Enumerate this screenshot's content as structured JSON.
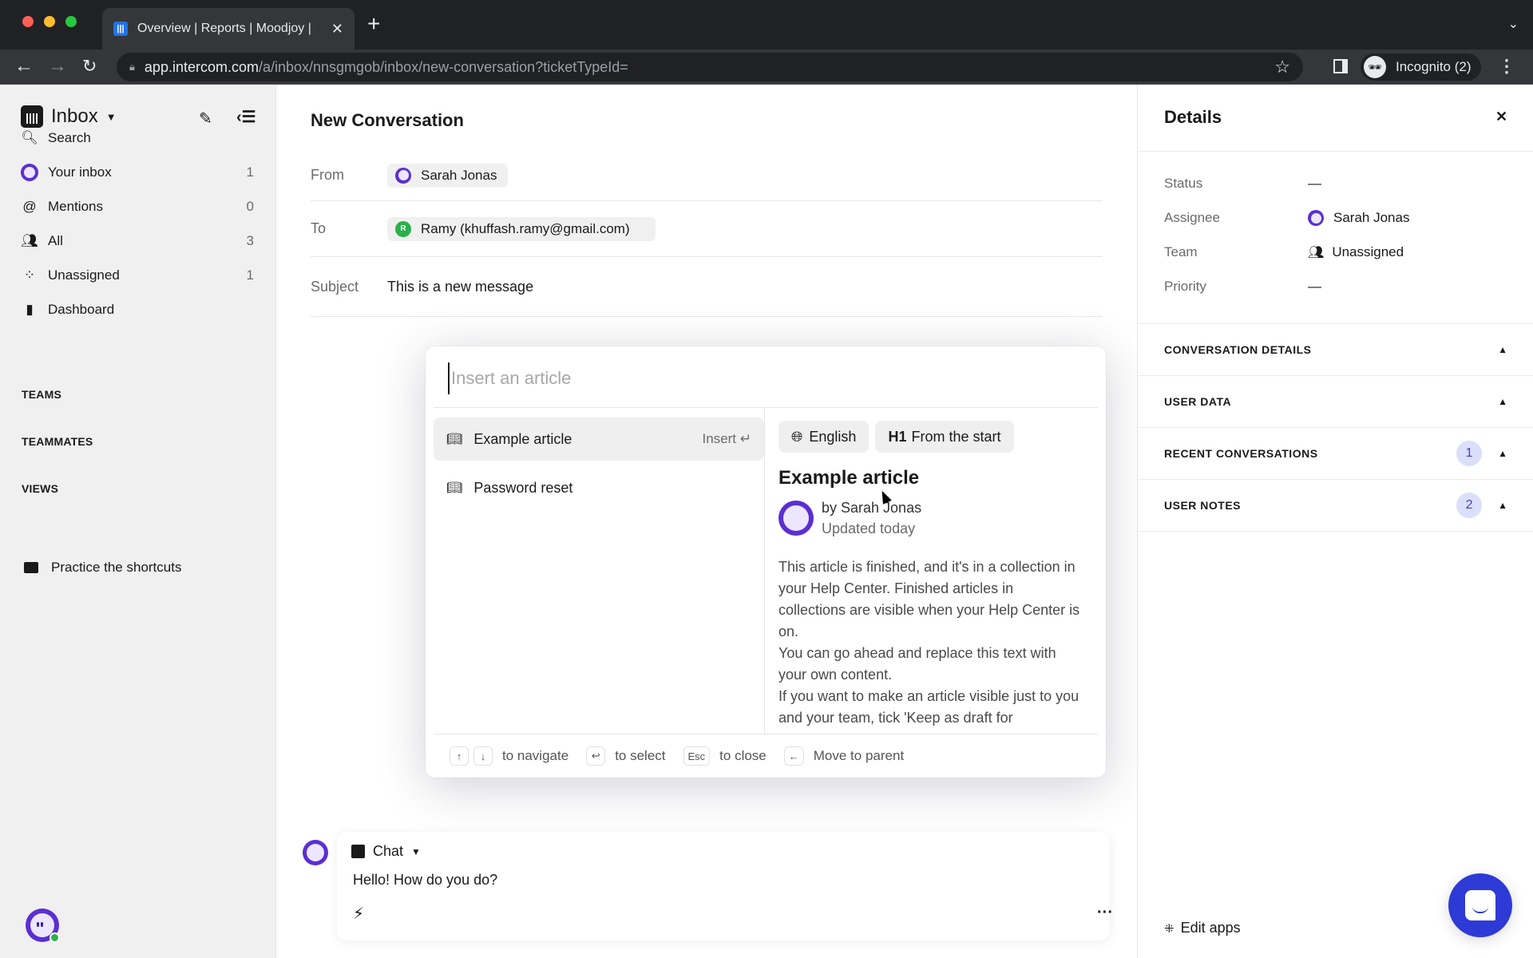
{
  "browser": {
    "tab_title": "Overview | Reports | Moodjoy |",
    "new_tab": "+",
    "url_host": "app.intercom.com",
    "url_path": "/a/inbox/nnsgmgob/inbox/new-conversation?ticketTypeId=",
    "profile_label": "Incognito (2)"
  },
  "sidebar": {
    "title": "Inbox",
    "search_label": "Search",
    "items": [
      {
        "label": "Your inbox",
        "count": "1",
        "icon": "avatar-ghost"
      },
      {
        "label": "Mentions",
        "count": "0",
        "icon": "at-icon"
      },
      {
        "label": "All",
        "count": "3",
        "icon": "people-icon"
      },
      {
        "label": "Unassigned",
        "count": "1",
        "icon": "unassigned-icon"
      },
      {
        "label": "Dashboard",
        "count": "",
        "icon": "bar-chart-icon"
      }
    ],
    "sections": [
      "TEAMS",
      "TEAMMATES",
      "VIEWS"
    ],
    "shortcuts_label": "Practice the shortcuts"
  },
  "conversation": {
    "title": "New Conversation",
    "from_label": "From",
    "from_value": "Sarah Jonas",
    "to_label": "To",
    "to_initial": "R",
    "to_value": "Ramy (khuffash.ramy@gmail.com)",
    "subject_label": "Subject",
    "subject_value": "This is a new message"
  },
  "article_picker": {
    "placeholder": "Insert an article",
    "items": [
      {
        "label": "Example article",
        "hint": "Insert ↵"
      },
      {
        "label": "Password reset",
        "hint": ""
      }
    ],
    "preview": {
      "language_chip": "English",
      "heading_chip_prefix": "H1",
      "heading_chip": "From the start",
      "title": "Example article",
      "author": "by Sarah Jonas",
      "updated": "Updated today",
      "body": [
        "This article is finished, and it's in a collection in your Help Center. Finished articles in collections are visible when your Help Center is on.",
        "You can go ahead and replace this text with your own content.",
        "If you want to make an article visible just to you and your team, tick 'Keep as draft for"
      ]
    },
    "footer": {
      "up_key": "↑",
      "down_key": "↓",
      "navigate": "to navigate",
      "enter_key": "↩",
      "select": "to select",
      "esc_key": "Esc",
      "close": "to close",
      "back_key": "←",
      "parent": "Move to parent"
    }
  },
  "composer": {
    "mode": "Chat",
    "text": "Hello! How do you do?"
  },
  "details": {
    "title": "Details",
    "rows": [
      {
        "label": "Status",
        "value": "—"
      },
      {
        "label": "Assignee",
        "value": "Sarah Jonas"
      },
      {
        "label": "Team",
        "value": "Unassigned"
      },
      {
        "label": "Priority",
        "value": "—"
      }
    ],
    "sections": [
      {
        "label": "CONVERSATION DETAILS",
        "badge": ""
      },
      {
        "label": "USER DATA",
        "badge": ""
      },
      {
        "label": "RECENT CONVERSATIONS",
        "badge": "1"
      },
      {
        "label": "USER NOTES",
        "badge": "2"
      }
    ],
    "edit_apps": "Edit apps"
  },
  "colors": {
    "accent": "#2d3ad6",
    "avatar_purple": "#5b2fd1",
    "online_green": "#2bb14a",
    "badge_bg": "#dcdff9"
  }
}
